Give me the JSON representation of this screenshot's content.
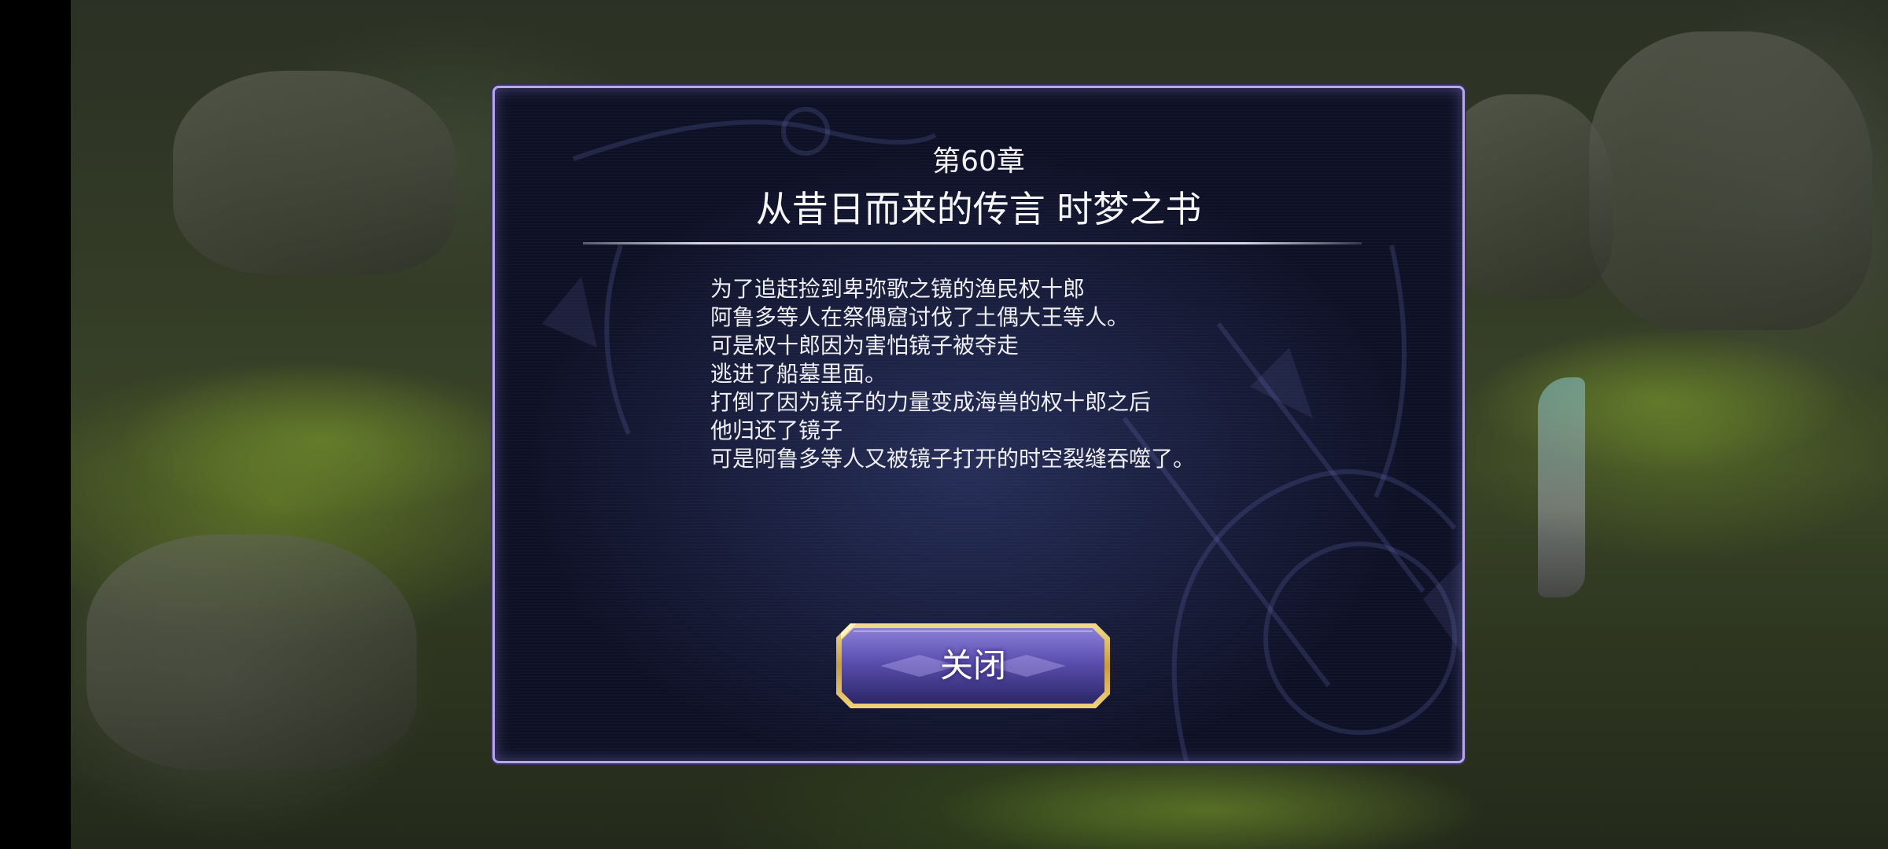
{
  "dialog": {
    "chapter": "第60章",
    "title": "从昔日而来的传言 时梦之书",
    "story_lines": [
      "为了追赶捡到卑弥歌之镜的渔民权十郎",
      "阿鲁多等人在祭偶窟讨伐了土偶大王等人。",
      "可是权十郎因为害怕镜子被夺走",
      "逃进了船墓里面。",
      "打倒了因为镜子的力量变成海兽的权十郎之后",
      "他归还了镜子",
      "可是阿鲁多等人又被镜子打开的时空裂缝吞噬了。"
    ],
    "close_label": "关闭"
  },
  "colors": {
    "dialog_border": "#b9a8e8",
    "button_gold": "#d9b65a",
    "button_purple": "#6a5bb8"
  }
}
